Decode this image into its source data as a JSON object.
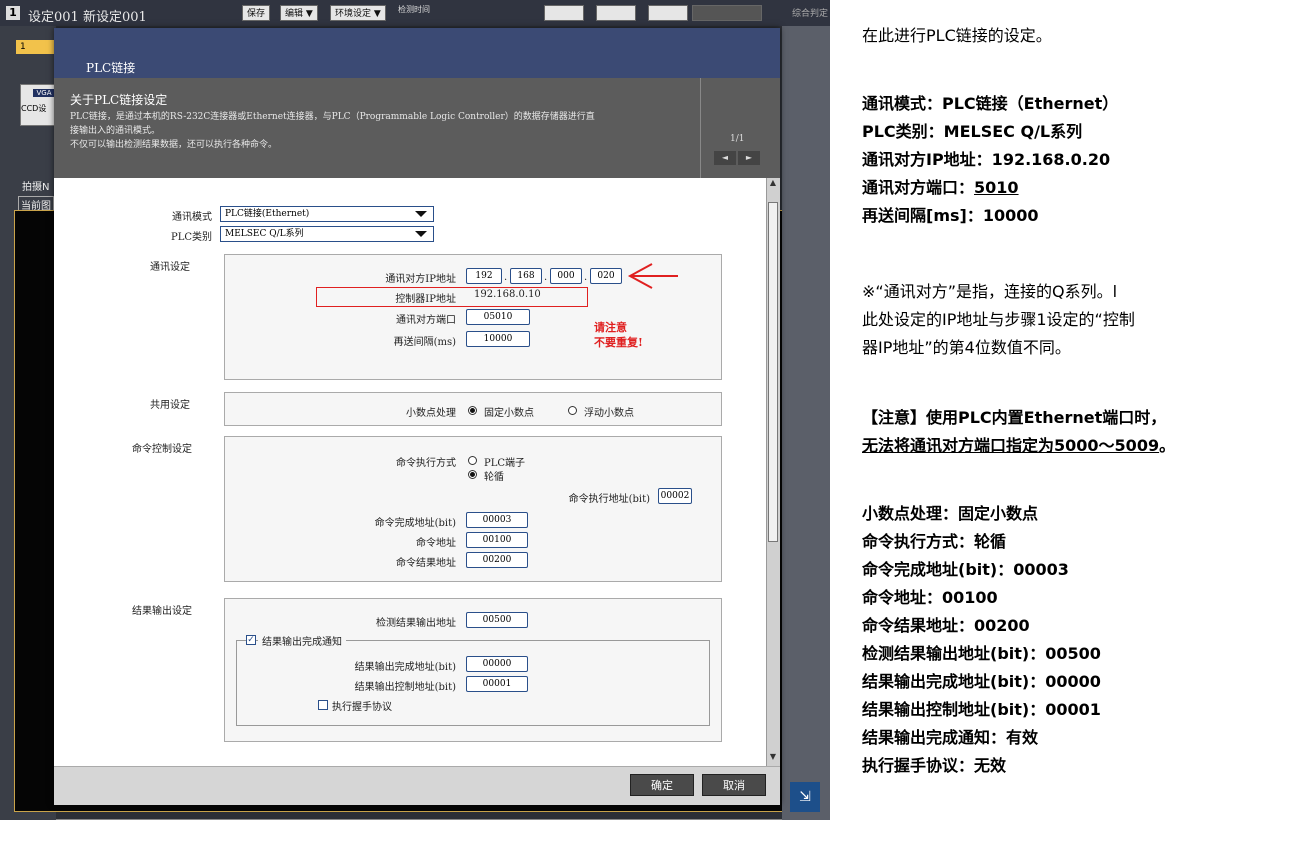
{
  "app": {
    "tab_number": "1",
    "title": "设定001  新设定001",
    "save_label": "保存",
    "edit_label": "编辑 ▼",
    "env_label": "环境设定 ▼",
    "time_label": "检测时间",
    "result_label": "综合判定",
    "result_value": "- -",
    "tab_label": "1",
    "ccd_label": "CCD设",
    "vga_label": "VGA",
    "shoot_label": "拍摄N",
    "current_label": "当前图"
  },
  "dialog": {
    "title": "PLC链接",
    "about_title": "关于PLC链接设定",
    "about_line1": "PLC链接，是通过本机的RS-232C连接器或Ethernet连接器，与PLC（Programmable Logic Controller）的数据存储器进行直",
    "about_line2": "接输出入的通讯模式。",
    "about_line3": "不仅可以输出检测结果数据，还可以执行各种命令。",
    "page": "1/1",
    "prev": "◄",
    "next": "►",
    "comm_mode_label": "通讯模式",
    "comm_mode_value": "PLC链接(Ethernet)",
    "plc_type_label": "PLC类别",
    "plc_type_value": "MELSEC Q/L系列",
    "comm_settings_label": "通讯设定",
    "peer_ip_label": "通讯对方IP地址",
    "peer_ip": [
      "192",
      "168",
      "000",
      "020"
    ],
    "ctrl_ip_label": "控制器IP地址",
    "ctrl_ip_value": "192.168.0.10",
    "peer_port_label": "通讯对方端口",
    "peer_port_value": "05010",
    "retry_label": "再送间隔(ms)",
    "retry_value": "10000",
    "warn_line1": "请注意",
    "warn_line2": "不要重复!",
    "common_label": "共用设定",
    "decimal_label": "小数点处理",
    "decimal_fixed": "固定小数点",
    "decimal_float": "浮动小数点",
    "cmd_ctrl_label": "命令控制设定",
    "cmd_exec_label": "命令执行方式",
    "cmd_exec_plc": "PLC端子",
    "cmd_exec_poll": "轮循",
    "cmd_exec_addr_label": "命令执行地址(bit)",
    "cmd_exec_addr_value": "00002",
    "cmd_done_label": "命令完成地址(bit)",
    "cmd_done_value": "00003",
    "cmd_addr_label": "命令地址",
    "cmd_addr_value": "00100",
    "cmd_result_label": "命令结果地址",
    "cmd_result_value": "00200",
    "result_out_label": "结果输出设定",
    "det_out_label": "检测结果输出地址",
    "det_out_value": "00500",
    "notify_label": "结果输出完成通知",
    "notify_check": "✓",
    "out_done_label": "结果输出完成地址(bit)",
    "out_done_value": "00000",
    "out_ctrl_label": "结果输出控制地址(bit)",
    "out_ctrl_value": "00001",
    "handshake_label": "执行握手协议",
    "ok": "确定",
    "cancel": "取消"
  },
  "notes": {
    "intro": "在此进行PLC链接的设定。",
    "mode": "通讯模式：PLC链接（Ethernet）",
    "type": "PLC类别：MELSEC Q/L系列",
    "peer_ip": "通讯对方IP地址：192.168.0.20",
    "peer_port_prefix": "通讯对方端口：",
    "peer_port_value": "5010",
    "retry": "再送间隔[ms]：10000",
    "remark1": "※“通讯对方”是指，连接的Q系列。l",
    "remark2": "此处设定的IP地址与步骤1设定的“控制",
    "remark3": "器IP地址”的第4位数值不同。",
    "caution1": "【注意】使用PLC内置Ethernet端口时，",
    "caution2a": "无法将通讯对方端口",
    "caution2b": "指定为5000～5009",
    "caution2c": "。",
    "decimal": "小数点处理：固定小数点",
    "exec_mode": "命令执行方式：轮循",
    "done_addr": "命令完成地址(bit)：00003",
    "cmd_addr": "命令地址：00100",
    "cmd_result": "命令结果地址：00200",
    "det_addr": "检测结果输出地址(bit)：00500",
    "out_done": "结果输出完成地址(bit)：00000",
    "out_ctrl": "结果输出控制地址(bit)：00001",
    "notify": "结果输出完成通知：有效",
    "handshake": "执行握手协议：无效"
  },
  "colors": {
    "highlight": "#e02020",
    "dialog_header": "#3b4a74",
    "field_border": "#2a4f8a"
  }
}
